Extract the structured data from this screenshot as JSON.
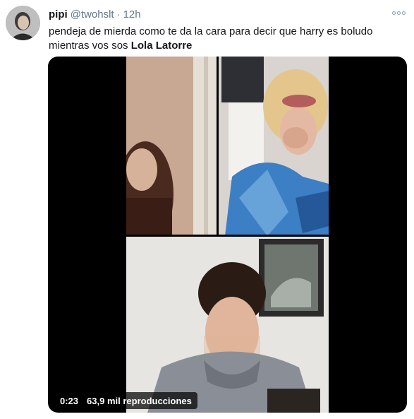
{
  "tweet": {
    "display_name": "pipi",
    "handle": "@twohslt",
    "separator": "·",
    "time": "12h",
    "text_line1": "pendeja de mierda como te da la cara para decir que harry es boludo",
    "text_line2_prefix": "mientras vos sos ",
    "text_line2_bold": "Lola Latorre"
  },
  "video": {
    "elapsed": "0:23",
    "views": "63,9 mil reproducciones"
  },
  "icons": {
    "avatar": "user-avatar-photo",
    "more": "more-options-icon"
  }
}
